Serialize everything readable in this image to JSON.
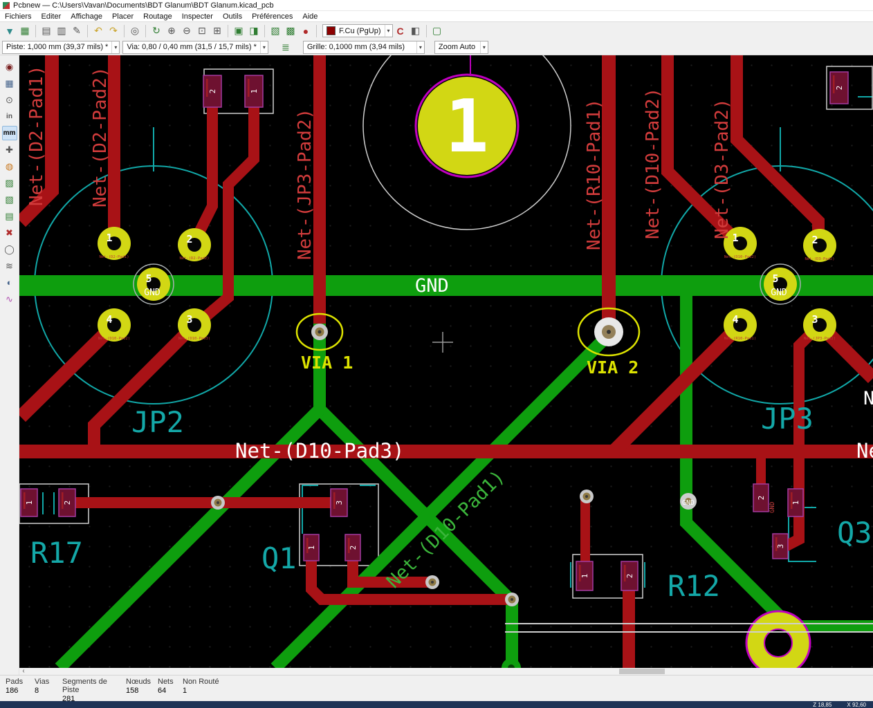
{
  "window": {
    "title": "Pcbnew — C:\\Users\\Vavan\\Documents\\BDT Glanum\\BDT Glanum.kicad_pcb"
  },
  "menubar": {
    "items": [
      "Fichiers",
      "Editer",
      "Affichage",
      "Placer",
      "Routage",
      "Inspecter",
      "Outils",
      "Préférences",
      "Aide"
    ]
  },
  "toolbar_main": {
    "icons": [
      {
        "name": "save-icon",
        "glyph": "▼"
      },
      {
        "name": "board-setup-icon",
        "glyph": "▦"
      },
      {
        "name": "page-settings-icon",
        "glyph": "▤"
      },
      {
        "name": "print-icon",
        "glyph": "▥"
      },
      {
        "name": "plot-icon",
        "glyph": "✎"
      },
      {
        "name": "undo-icon",
        "glyph": "↶"
      },
      {
        "name": "redo-icon",
        "glyph": "↷"
      },
      {
        "name": "find-icon",
        "glyph": "◎"
      },
      {
        "name": "refresh-icon",
        "glyph": "↻"
      },
      {
        "name": "zoom-in-icon",
        "glyph": "⊕"
      },
      {
        "name": "zoom-out-icon",
        "glyph": "⊖"
      },
      {
        "name": "zoom-fit-icon",
        "glyph": "⊡"
      },
      {
        "name": "zoom-selection-icon",
        "glyph": "⊞"
      },
      {
        "name": "footprint-editor-icon",
        "glyph": "▣"
      },
      {
        "name": "footprint-browser-icon",
        "glyph": "◨"
      },
      {
        "name": "netlist-icon",
        "glyph": "▧"
      },
      {
        "name": "update-pcb-icon",
        "glyph": "▩"
      },
      {
        "name": "drc-icon",
        "glyph": "●"
      },
      {
        "name": "highlight-net-icon",
        "glyph": "C"
      },
      {
        "name": "layer-pair-icon",
        "glyph": "◧"
      },
      {
        "name": "layers-toolbar-icon",
        "glyph": "▢"
      }
    ],
    "layer_selector": {
      "value": "F.Cu (PgUp)",
      "swatch_color": "#8c0000"
    }
  },
  "toolbar_options": {
    "track": "Piste: 1,000 mm (39,37 mils) *",
    "via": "Via: 0,80 / 0,40 mm (31,5 / 15,7 mils) *",
    "grid": "Grille: 0,1000 mm (3,94 mils)",
    "zoom": "Zoom Auto",
    "mid_icon": {
      "name": "auto-track-width-icon",
      "glyph": "≣"
    }
  },
  "sidebar": {
    "icons": [
      {
        "name": "drc-toggle-icon",
        "glyph": "◉"
      },
      {
        "name": "grid-toggle-icon",
        "glyph": "▦"
      },
      {
        "name": "polar-coords-icon",
        "glyph": "⊙"
      },
      {
        "name": "units-inch-icon",
        "glyph": "in"
      },
      {
        "name": "units-mm-icon",
        "glyph": "mm",
        "selected": true
      },
      {
        "name": "cursor-shape-icon",
        "glyph": "✚"
      },
      {
        "name": "ratsnest-icon",
        "glyph": "◍"
      },
      {
        "name": "zone-filled-icon",
        "glyph": "▨"
      },
      {
        "name": "zone-outline-icon",
        "glyph": "▧"
      },
      {
        "name": "zone-hidden-icon",
        "glyph": "▤"
      },
      {
        "name": "zones-off-icon",
        "glyph": "✖"
      },
      {
        "name": "pads-sketch-icon",
        "glyph": "◯"
      },
      {
        "name": "tracks-sketch-icon",
        "glyph": "≋"
      },
      {
        "name": "contrast-mode-icon",
        "glyph": "◐"
      },
      {
        "name": "layers-manager-icon",
        "glyph": "∿"
      }
    ]
  },
  "pcb": {
    "colors": {
      "copper_front": "#a81216",
      "copper_back_gnd": "#0e9e0e",
      "silkscreen": "#11a8a8",
      "pad_yellow": "#d2d714",
      "highlight_yellow": "#dde300",
      "magenta": "#c000c0"
    },
    "net_labels": {
      "d2_pad1": "Net-(D2-Pad1)",
      "d2_pad2": "Net-(D2-Pad2)",
      "jp3_pad2": "Net-(JP3-Pad2)",
      "r10_pad1": "Net-(R10-Pad1)",
      "d10_pad2": "Net-(D10-Pad2)",
      "d3_pad2": "Net-(D3-Pad2)",
      "d10_pad3": "Net-(D10-Pad3)",
      "d10_pad1": "Net-(D10-Pad1)",
      "edge_ne": "Ne",
      "edge_n": "N"
    },
    "gnd_label": "GND",
    "via1_label": "VIA 1",
    "via2_label": "VIA 2",
    "big_pad": "1",
    "refs": {
      "jp2": "JP2",
      "jp3": "JP3",
      "r17": "R17",
      "q1": "Q1",
      "r12": "R12",
      "q3": "Q3"
    },
    "jp2_pads": {
      "p1": "1",
      "p2": "2",
      "p3": "3",
      "p4": "4",
      "p5": "5"
    },
    "jp2_gnd": "GND",
    "jp3_pads": {
      "p1": "1",
      "p2": "2",
      "p3": "3",
      "p4": "4",
      "p5": "5"
    },
    "jp3_gnd": "GND",
    "pad_nets": {
      "jp2_p1": "Net-(D2-Pad1)",
      "jp2_p2": "Net-(D2-Pad2)",
      "jp2_p3": "Net-(D10-Pad3)",
      "jp2_p4": "Net-(D10-Pad2)",
      "jp3_p1": "Net-(D10-Pad2)",
      "jp3_p2": "Net-(D3-Pad2)",
      "jp3_p3": "Net-(JP3-Pad2)",
      "jp3_p4": "Net-(R10-Pad1)"
    },
    "top_pads": {
      "left": "2",
      "right": "1"
    },
    "top_right_pad": "2",
    "r17_pads": {
      "p1": "1",
      "p2": "2"
    },
    "q1_pads": {
      "p1": "1",
      "p2": "2",
      "p3": "3"
    },
    "r12_pads": {
      "p1": "1",
      "p2": "2"
    },
    "q3_pads": {
      "p1": "1",
      "p2": "2",
      "p3": "3"
    },
    "q3_gnd_pad": "GND",
    "q3_gnd_net": "GND"
  },
  "statusbar": {
    "stats": [
      {
        "label": "Pads",
        "value": "186"
      },
      {
        "label": "Vias",
        "value": "8"
      },
      {
        "label": "Segments de Piste",
        "value": "281"
      },
      {
        "label": "Nœuds",
        "value": "158"
      },
      {
        "label": "Nets",
        "value": "64"
      },
      {
        "label": "Non Routé",
        "value": "1"
      }
    ],
    "scroll_arrow": "‹"
  },
  "coords": {
    "zoom": "Z 18,85",
    "x": "X 92,60"
  }
}
